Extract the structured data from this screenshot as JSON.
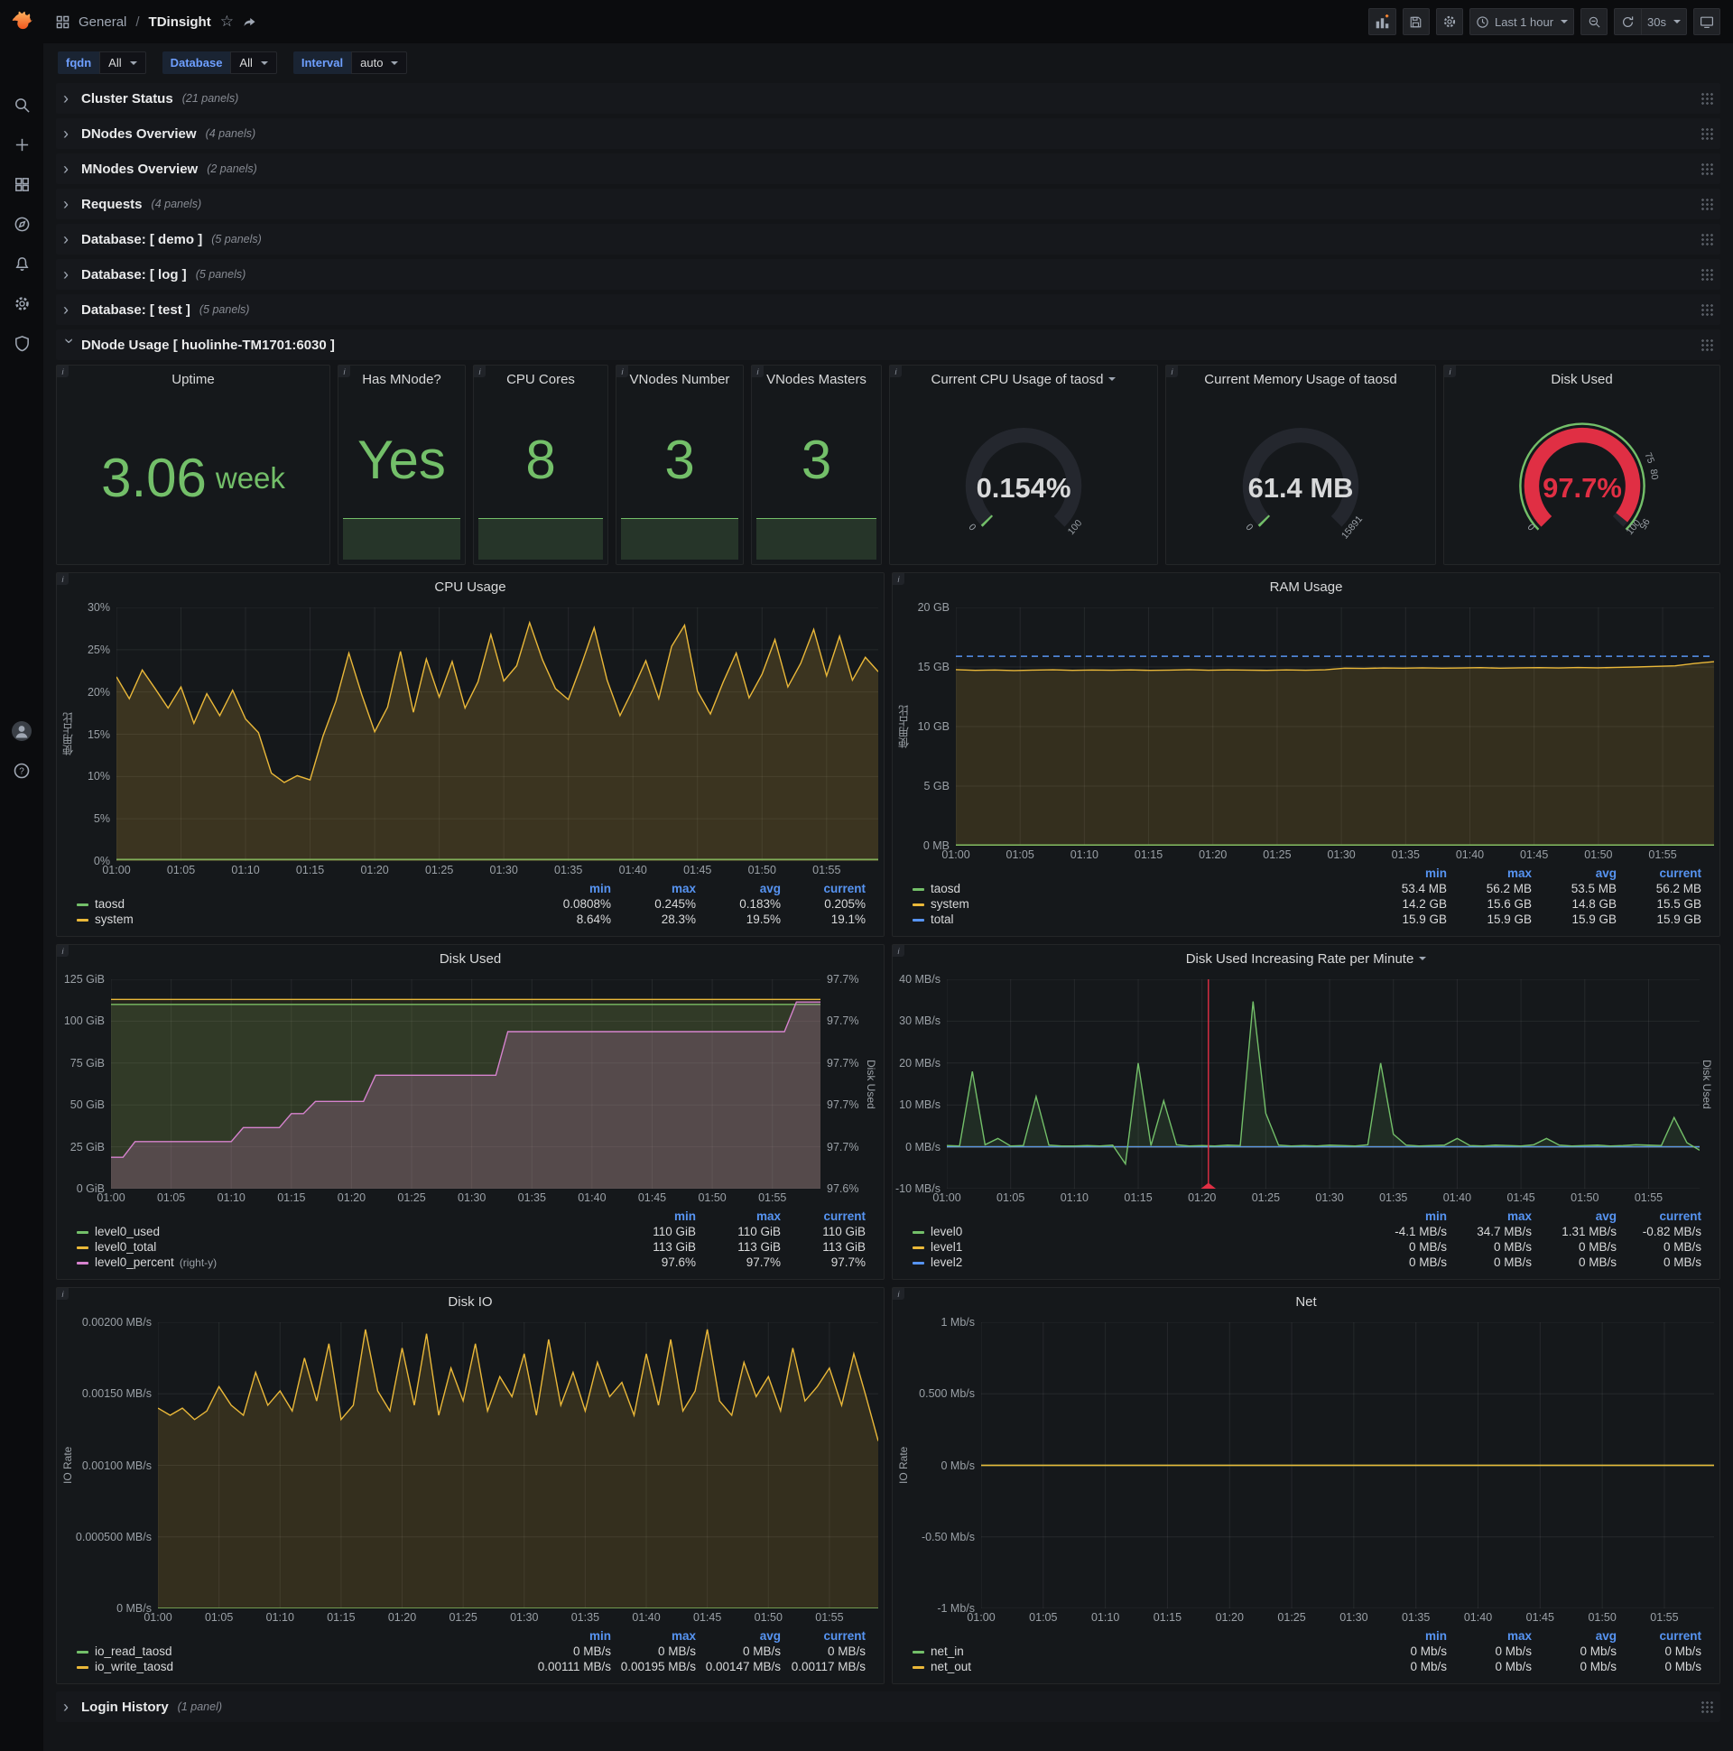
{
  "topnav": {
    "breadcrumb_section": "General",
    "breadcrumb_sep": "/",
    "breadcrumb_title": "TDinsight",
    "time_range": "Last 1 hour",
    "refresh_interval": "30s"
  },
  "filters": [
    {
      "label": "fqdn",
      "value": "All"
    },
    {
      "label": "Database",
      "value": "All"
    },
    {
      "label": "Interval",
      "value": "auto"
    }
  ],
  "rows_top": [
    {
      "title": "Cluster Status",
      "count": "(21 panels)"
    },
    {
      "title": "DNodes Overview",
      "count": "(4 panels)"
    },
    {
      "title": "MNodes Overview",
      "count": "(2 panels)"
    },
    {
      "title": "Requests",
      "count": "(4 panels)"
    },
    {
      "title": "Database: [ demo ]",
      "count": "(5 panels)"
    },
    {
      "title": "Database: [ log ]",
      "count": "(5 panels)"
    },
    {
      "title": "Database: [ test ]",
      "count": "(5 panels)"
    }
  ],
  "expanded_row": {
    "title": "DNode Usage [ huolinhe-TM1701:6030 ]"
  },
  "rows_bottom": [
    {
      "title": "Login History",
      "count": "(1 panel)"
    }
  ],
  "stats": {
    "uptime": {
      "title": "Uptime",
      "value": "3.06",
      "unit": "week"
    },
    "has_mnode": {
      "title": "Has MNode?",
      "value": "Yes"
    },
    "cpu_cores": {
      "title": "CPU Cores",
      "value": "8"
    },
    "vnodes_number": {
      "title": "VNodes Number",
      "value": "3"
    },
    "vnodes_masters": {
      "title": "VNodes Masters",
      "value": "3"
    }
  },
  "gauges": {
    "cpu": {
      "title": "Current CPU Usage of taosd",
      "display": "0.154%",
      "value": 0.154,
      "min": 0,
      "max": 100,
      "min_label": "0",
      "max_label": "100",
      "color": "#73bf69",
      "value_color": "#d8d9da"
    },
    "memory": {
      "title": "Current Memory Usage of taosd",
      "display": "61.4 MB",
      "value": 61.4,
      "min": 0,
      "max": 15891,
      "min_label": "0",
      "max_label": "15891",
      "color": "#73bf69",
      "value_color": "#d8d9da"
    },
    "disk": {
      "title": "Disk Used",
      "display": "97.7%",
      "value": 97.7,
      "min": 0,
      "max": 100,
      "min_label": "0",
      "max_label": "100",
      "color": "#e02f44",
      "value_color": "#e02f44",
      "ring_color": "#73bf69",
      "thresholds": [
        {
          "value": 75,
          "label": "75"
        },
        {
          "value": 80,
          "label": "80"
        },
        {
          "value": 95,
          "label": "95"
        }
      ]
    }
  },
  "panels": {
    "cpu_usage": {
      "type": "line",
      "title": "CPU Usage",
      "ylabel": "使用占比",
      "ylim": [
        0,
        30
      ],
      "axis_width": 46,
      "yticks": [
        "30%",
        "25%",
        "20%",
        "15%",
        "10%",
        "5%",
        "0%"
      ],
      "xticks": [
        "01:00",
        "01:05",
        "01:10",
        "01:15",
        "01:20",
        "01:25",
        "01:30",
        "01:35",
        "01:40",
        "01:45",
        "01:50",
        "01:55"
      ],
      "series": [
        {
          "name": "taosd",
          "color": "#73bf69",
          "fill": 0.1,
          "values": [
            0.2,
            0.2
          ]
        },
        {
          "name": "system",
          "color": "#eab839",
          "fill": 0.18,
          "values": [
            21.8,
            19.2,
            22.6,
            20.4,
            18.1,
            20.6,
            16.3,
            19.8,
            17.2,
            20.2,
            16.8,
            15.2,
            10.4,
            9.3,
            10.1,
            9.6,
            14.8,
            18.9,
            24.6,
            19.7,
            15.3,
            18.2,
            24.8,
            17.6,
            23.9,
            19.4,
            23.6,
            18.1,
            21.2,
            26.8,
            21.3,
            23.1,
            28.2,
            23.8,
            20.4,
            19.1,
            23.2,
            27.6,
            21.4,
            17.2,
            20.3,
            23.7,
            19.2,
            25.4,
            27.9,
            20.1,
            17.4,
            21.2,
            24.6,
            19.3,
            22.1,
            26.2,
            20.6,
            23.4,
            27.4,
            21.9,
            26.6,
            21.4,
            24.1,
            22.4
          ]
        }
      ],
      "legend": {
        "columns": [
          "min",
          "max",
          "avg",
          "current"
        ],
        "rows": [
          {
            "name": "taosd",
            "color": "#73bf69",
            "values": [
              "0.0808%",
              "0.245%",
              "0.183%",
              "0.205%"
            ]
          },
          {
            "name": "system",
            "color": "#eab839",
            "values": [
              "8.64%",
              "28.3%",
              "19.5%",
              "19.1%"
            ]
          }
        ]
      }
    },
    "ram_usage": {
      "type": "line",
      "title": "RAM Usage",
      "ylabel": "使用占比",
      "ylim": [
        0,
        20
      ],
      "axis_width": 50,
      "yticks": [
        "20 GB",
        "15 GB",
        "10 GB",
        "5 GB",
        "0 MB"
      ],
      "xticks": [
        "01:00",
        "01:05",
        "01:10",
        "01:15",
        "01:20",
        "01:25",
        "01:30",
        "01:35",
        "01:40",
        "01:45",
        "01:50",
        "01:55"
      ],
      "series": [
        {
          "name": "taosd",
          "color": "#73bf69",
          "fill": 0.1,
          "values": [
            0.055,
            0.055
          ]
        },
        {
          "name": "system",
          "color": "#eab839",
          "fill": 0.15,
          "values": [
            14.78,
            14.72,
            14.75,
            14.7,
            14.74,
            14.77,
            14.72,
            14.75,
            14.73,
            14.76,
            14.72,
            14.74,
            14.78,
            14.73,
            14.76,
            14.74,
            14.72,
            14.76,
            14.73,
            14.77,
            14.9,
            14.88,
            14.92,
            14.9,
            14.93,
            14.9,
            14.92,
            14.95,
            14.9,
            14.93,
            14.95,
            14.92,
            14.96,
            14.93,
            14.97,
            15.0,
            15.05,
            15.1,
            15.3,
            15.45
          ]
        },
        {
          "name": "total",
          "color": "#5794f2",
          "dash": true,
          "values": [
            15.9,
            15.9
          ]
        }
      ],
      "legend": {
        "columns": [
          "min",
          "max",
          "avg",
          "current"
        ],
        "rows": [
          {
            "name": "taosd",
            "color": "#73bf69",
            "values": [
              "53.4 MB",
              "56.2 MB",
              "53.5 MB",
              "56.2 MB"
            ]
          },
          {
            "name": "system",
            "color": "#eab839",
            "values": [
              "14.2 GB",
              "15.6 GB",
              "14.8 GB",
              "15.5 GB"
            ]
          },
          {
            "name": "total",
            "color": "#5794f2",
            "values": [
              "15.9 GB",
              "15.9 GB",
              "15.9 GB",
              "15.9 GB"
            ]
          }
        ]
      }
    },
    "disk_used": {
      "type": "line",
      "title": "Disk Used",
      "ylim": [
        0,
        125
      ],
      "axis_width": 56,
      "yticks": [
        "125 GiB",
        "100 GiB",
        "75 GiB",
        "50 GiB",
        "25 GiB",
        "0 GiB"
      ],
      "right_ylabel": "Disk Used",
      "right_ylim": [
        97.59,
        97.71
      ],
      "right_axis_width": 48,
      "right_yticks": [
        "97.7%",
        "97.7%",
        "97.7%",
        "97.7%",
        "97.7%",
        "97.6%"
      ],
      "xticks": [
        "01:00",
        "01:05",
        "01:10",
        "01:15",
        "01:20",
        "01:25",
        "01:30",
        "01:35",
        "01:40",
        "01:45",
        "01:50",
        "01:55"
      ],
      "series": [
        {
          "name": "level0_used",
          "color": "#73bf69",
          "fill": 0.15,
          "values": [
            110,
            110
          ]
        },
        {
          "name": "level0_total",
          "color": "#eab839",
          "fill": 0.08,
          "values": [
            113,
            113
          ]
        },
        {
          "name": "level0_percent",
          "color": "#d683ce",
          "fill": 0.22,
          "axis": "right",
          "values": [
            97.608,
            97.608,
            97.617,
            97.617,
            97.617,
            97.617,
            97.617,
            97.617,
            97.617,
            97.617,
            97.617,
            97.625,
            97.625,
            97.625,
            97.625,
            97.633,
            97.633,
            97.64,
            97.64,
            97.64,
            97.64,
            97.64,
            97.655,
            97.655,
            97.655,
            97.655,
            97.655,
            97.655,
            97.655,
            97.655,
            97.655,
            97.655,
            97.655,
            97.68,
            97.68,
            97.68,
            97.68,
            97.68,
            97.68,
            97.68,
            97.68,
            97.68,
            97.68,
            97.68,
            97.68,
            97.68,
            97.68,
            97.68,
            97.68,
            97.68,
            97.68,
            97.68,
            97.68,
            97.68,
            97.68,
            97.68,
            97.68,
            97.697,
            97.697,
            97.697
          ]
        }
      ],
      "legend": {
        "columns": [
          "min",
          "max",
          "current"
        ],
        "rows": [
          {
            "name": "level0_used",
            "color": "#73bf69",
            "values": [
              "110 GiB",
              "110 GiB",
              "110 GiB"
            ]
          },
          {
            "name": "level0_total",
            "color": "#eab839",
            "values": [
              "113 GiB",
              "113 GiB",
              "113 GiB"
            ]
          },
          {
            "name": "level0_percent",
            "note": "(right-y)",
            "color": "#d683ce",
            "values": [
              "97.6%",
              "97.7%",
              "97.7%"
            ]
          }
        ]
      }
    },
    "disk_rate": {
      "type": "line",
      "title": "Disk Used Increasing Rate per Minute",
      "has_caret": true,
      "ylim": [
        -10,
        40
      ],
      "axis_width": 56,
      "yticks": [
        "40 MB/s",
        "30 MB/s",
        "20 MB/s",
        "10 MB/s",
        "0 MB/s",
        "-10 MB/s"
      ],
      "right_ylabel": "Disk Used",
      "annotation_x": 20.5,
      "xticks": [
        "01:00",
        "01:05",
        "01:10",
        "01:15",
        "01:20",
        "01:25",
        "01:30",
        "01:35",
        "01:40",
        "01:45",
        "01:50",
        "01:55"
      ],
      "series": [
        {
          "name": "level1",
          "color": "#eab839",
          "values": [
            0,
            0
          ]
        },
        {
          "name": "level2",
          "color": "#5794f2",
          "values": [
            0,
            0
          ]
        },
        {
          "name": "level0",
          "color": "#73bf69",
          "fill": 0.12,
          "values": [
            0.3,
            0.2,
            18,
            0.5,
            2,
            0.2,
            0.3,
            12,
            0.4,
            0.2,
            0.2,
            0.3,
            0.2,
            0.4,
            -4.1,
            20,
            0.3,
            11,
            0.5,
            0.2,
            0.3,
            0.2,
            0.4,
            0.3,
            34.7,
            8,
            0.4,
            0.2,
            0.3,
            0.2,
            0.4,
            0.3,
            0.2,
            0.5,
            20,
            3,
            0.4,
            0.2,
            0.3,
            0.4,
            2,
            0.3,
            0.2,
            0.4,
            0.3,
            0.2,
            0.5,
            2,
            0.4,
            0.2,
            0.3,
            0.4,
            0.2,
            0.3,
            0.5,
            0.4,
            0.3,
            7,
            1,
            -0.82
          ]
        }
      ],
      "legend": {
        "columns": [
          "min",
          "max",
          "avg",
          "current"
        ],
        "rows": [
          {
            "name": "level0",
            "color": "#73bf69",
            "values": [
              "-4.1 MB/s",
              "34.7 MB/s",
              "1.31 MB/s",
              "-0.82 MB/s"
            ]
          },
          {
            "name": "level1",
            "color": "#eab839",
            "values": [
              "0 MB/s",
              "0 MB/s",
              "0 MB/s",
              "0 MB/s"
            ]
          },
          {
            "name": "level2",
            "color": "#5794f2",
            "values": [
              "0 MB/s",
              "0 MB/s",
              "0 MB/s",
              "0 MB/s"
            ]
          }
        ]
      }
    },
    "disk_io": {
      "type": "line",
      "title": "Disk IO",
      "ylabel": "IO Rate",
      "ylim": [
        0,
        0.002
      ],
      "axis_width": 92,
      "yticks": [
        "0.00200 MB/s",
        "0.00150 MB/s",
        "0.00100 MB/s",
        "0.000500 MB/s",
        "0 MB/s"
      ],
      "xticks": [
        "01:00",
        "01:05",
        "01:10",
        "01:15",
        "01:20",
        "01:25",
        "01:30",
        "01:35",
        "01:40",
        "01:45",
        "01:50",
        "01:55"
      ],
      "series": [
        {
          "name": "io_read_taosd",
          "color": "#73bf69",
          "values": [
            0,
            0
          ]
        },
        {
          "name": "io_write_taosd",
          "color": "#eab839",
          "fill": 0.15,
          "values": [
            0.0014,
            0.00135,
            0.0014,
            0.00132,
            0.00138,
            0.00155,
            0.00142,
            0.00135,
            0.00165,
            0.00142,
            0.00152,
            0.00138,
            0.00175,
            0.00145,
            0.00185,
            0.00132,
            0.00142,
            0.00195,
            0.00152,
            0.00138,
            0.00182,
            0.00142,
            0.00192,
            0.00135,
            0.00168,
            0.00145,
            0.00185,
            0.00138,
            0.00162,
            0.00148,
            0.00178,
            0.00135,
            0.00188,
            0.00142,
            0.00165,
            0.00138,
            0.00172,
            0.00148,
            0.00158,
            0.00135,
            0.00178,
            0.00142,
            0.00188,
            0.00138,
            0.00152,
            0.00195,
            0.00145,
            0.00135,
            0.00172,
            0.00148,
            0.00162,
            0.00138,
            0.00182,
            0.00145,
            0.00155,
            0.00168,
            0.00142,
            0.00178,
            0.00148,
            0.00117
          ]
        }
      ],
      "legend": {
        "columns": [
          "min",
          "max",
          "avg",
          "current"
        ],
        "rows": [
          {
            "name": "io_read_taosd",
            "color": "#73bf69",
            "values": [
              "0 MB/s",
              "0 MB/s",
              "0 MB/s",
              "0 MB/s"
            ]
          },
          {
            "name": "io_write_taosd",
            "color": "#eab839",
            "values": [
              "0.00111 MB/s",
              "0.00195 MB/s",
              "0.00147 MB/s",
              "0.00117 MB/s"
            ]
          }
        ]
      }
    },
    "net": {
      "type": "line",
      "title": "Net",
      "ylabel": "IO Rate",
      "ylim": [
        -1,
        1
      ],
      "axis_width": 78,
      "yticks": [
        "1 Mb/s",
        "0.500 Mb/s",
        "0 Mb/s",
        "-0.50 Mb/s",
        "-1 Mb/s"
      ],
      "xticks": [
        "01:00",
        "01:05",
        "01:10",
        "01:15",
        "01:20",
        "01:25",
        "01:30",
        "01:35",
        "01:40",
        "01:45",
        "01:50",
        "01:55"
      ],
      "series": [
        {
          "name": "net_in",
          "color": "#73bf69",
          "values": [
            0,
            0
          ]
        },
        {
          "name": "net_out",
          "color": "#eab839",
          "values": [
            0,
            0
          ]
        }
      ],
      "legend": {
        "columns": [
          "min",
          "max",
          "avg",
          "current"
        ],
        "rows": [
          {
            "name": "net_in",
            "color": "#73bf69",
            "values": [
              "0 Mb/s",
              "0 Mb/s",
              "0 Mb/s",
              "0 Mb/s"
            ]
          },
          {
            "name": "net_out",
            "color": "#eab839",
            "values": [
              "0 Mb/s",
              "0 Mb/s",
              "0 Mb/s",
              "0 Mb/s"
            ]
          }
        ]
      }
    }
  },
  "colors": {
    "green": "#73bf69",
    "yellow": "#eab839",
    "blue": "#5794f2",
    "red": "#e02f44",
    "pink": "#d683ce",
    "annotation": "#e02f44"
  }
}
